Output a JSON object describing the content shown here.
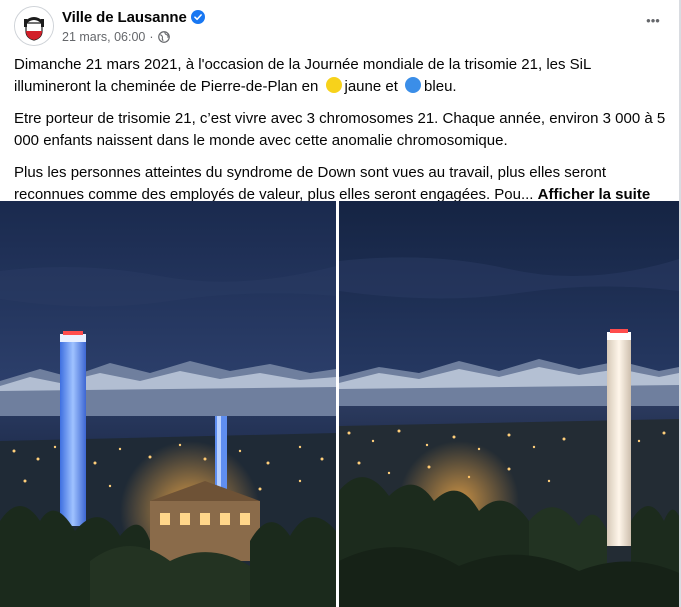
{
  "post": {
    "page_name": "Ville de Lausanne",
    "timestamp": "21 mars, 06:00",
    "separator": "·",
    "more_label": "•••",
    "paragraph1_part1": "Dimanche 21 mars 2021, à l'occasion de la Journée mondiale de la trisomie 21, les SiL illumineront la cheminée de Pierre-de-Plan en ",
    "paragraph1_yellow": "jaune et ",
    "paragraph1_blue": "bleu.",
    "paragraph2": "Etre porteur de trisomie 21, c’est vivre avec 3 chromosomes 21. Chaque année, environ 3 000 à 5 000 enfants naissent dans le monde avec cette anomalie chromosomique.",
    "paragraph3": "Plus les personnes atteintes du syndrome de Down sont vues au travail, plus elles seront reconnues comme des employés de valeur, plus elles seront engagées. Pou... ",
    "see_more": "Afficher la suite"
  },
  "icons": {
    "avatar": "lausanne-coat-of-arms",
    "verified": "verified-badge-icon",
    "privacy": "globe-icon",
    "emoji_yellow": "yellow-circle-emoji",
    "emoji_blue": "blue-circle-emoji"
  },
  "colors": {
    "accent_blue": "#1877f2",
    "meta_gray": "#65676b",
    "emoji_yellow": "#f7d21b",
    "emoji_blue": "#3b8ee8"
  }
}
